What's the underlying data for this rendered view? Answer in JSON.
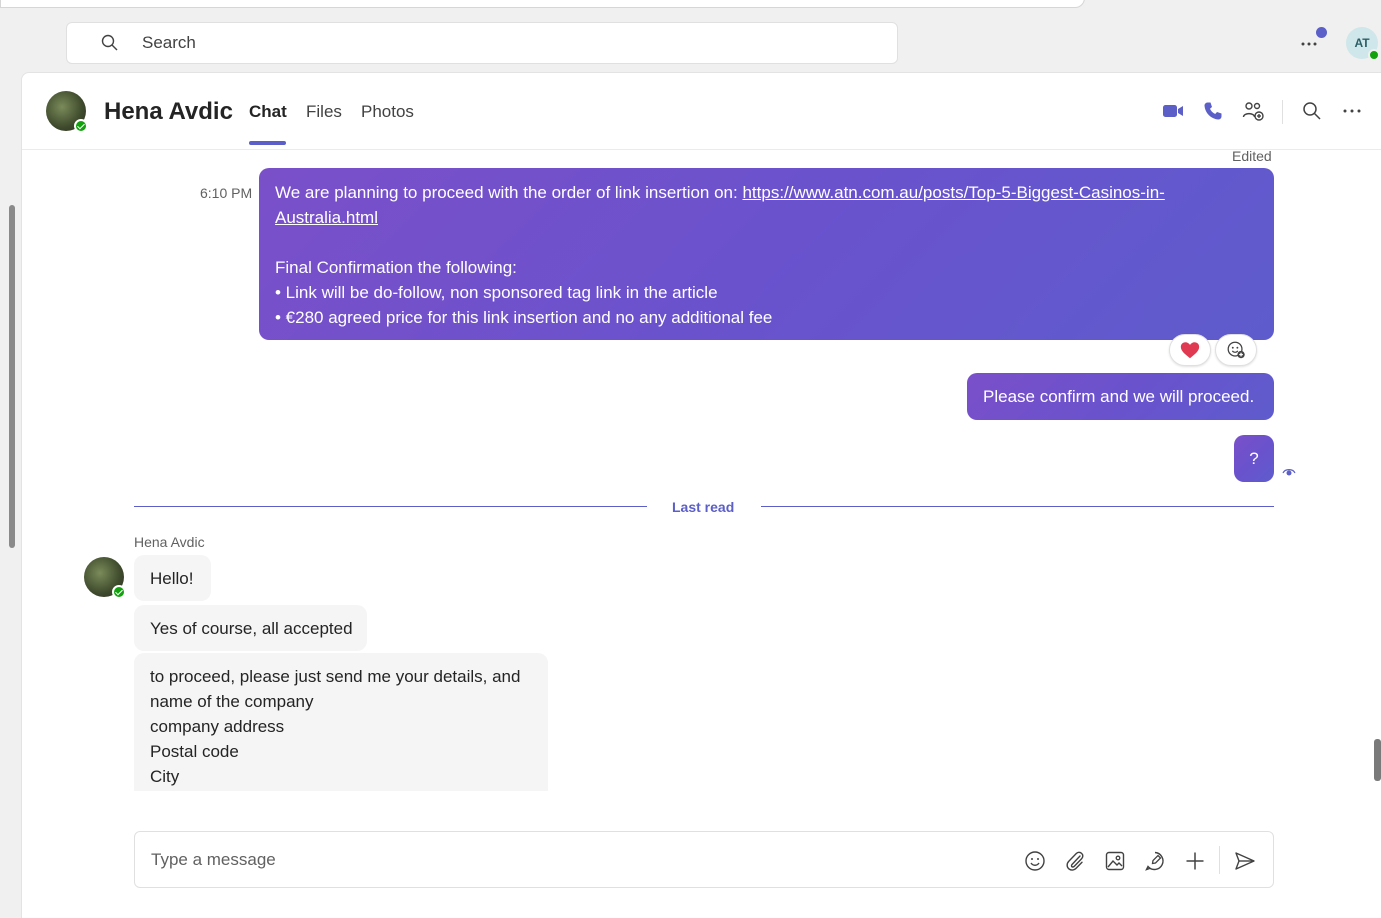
{
  "search": {
    "placeholder": "Search"
  },
  "user": {
    "initials": "AT"
  },
  "chat_header": {
    "name": "Hena Avdic",
    "tabs": [
      {
        "label": "Chat",
        "active": true
      },
      {
        "label": "Files",
        "active": false
      },
      {
        "label": "Photos",
        "active": false
      }
    ]
  },
  "messages": {
    "edited_label": "Edited",
    "m1_time": "6:10 PM",
    "m1_text_prefix": "We are planning to proceed with the order of link insertion on: ",
    "m1_link": "https://www.atn.com.au/posts/Top-5-Biggest-Casinos-in-Australia.html",
    "m1_line2": "Final Confirmation the following:",
    "m1_line3": "• Link will be do-follow, non sponsored tag link in the article",
    "m1_line4": "• €280 agreed price for this link insertion and no any additional fee",
    "m2_text": "Please confirm and we will proceed.",
    "m3_text": "?",
    "last_read_label": "Last read",
    "incoming_sender": "Hena Avdic",
    "in1_text": "Hello!",
    "in2_text": "Yes of course, all accepted",
    "in3_lines": [
      "to proceed, please just send me your details, and",
      "name of the company",
      "company address",
      "Postal code",
      "City"
    ]
  },
  "composer": {
    "placeholder": "Type a message"
  },
  "colors": {
    "accent": "#5b5fc7",
    "online": "#13a10e",
    "heart": "#e03a52"
  }
}
